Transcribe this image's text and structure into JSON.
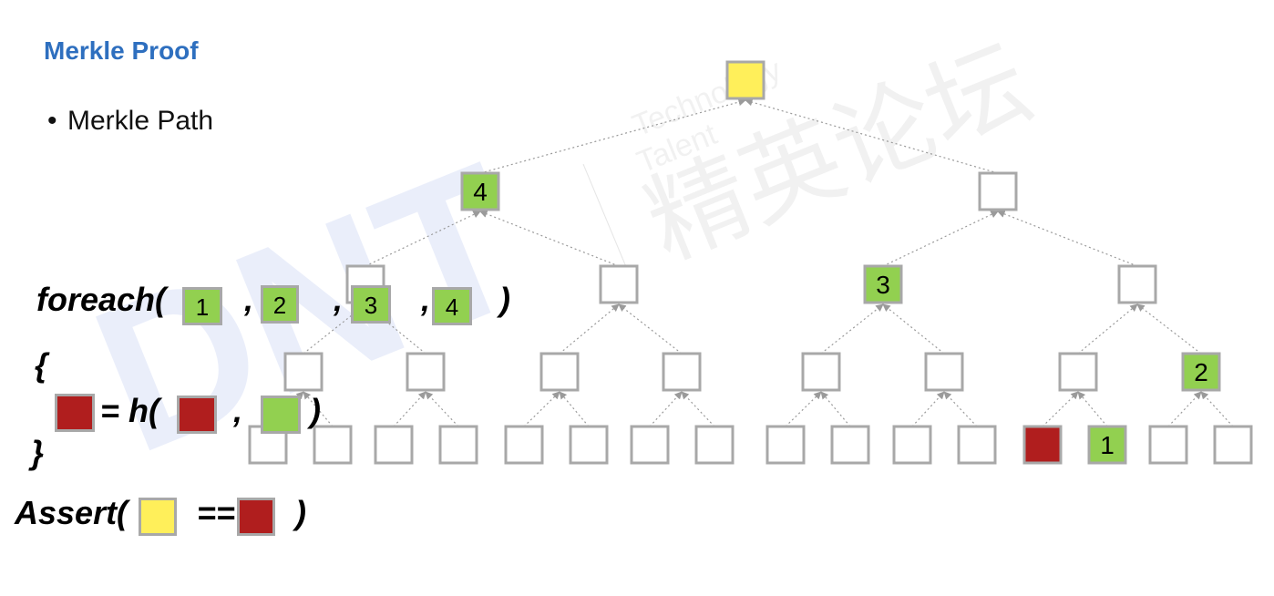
{
  "title": "Merkle Proof",
  "bullet": "Merkle Path",
  "colors": {
    "green": "#92d050",
    "yellow": "#ffef5a",
    "red": "#b01e1e",
    "border": "#a8a8a8",
    "title": "#2e6fbf"
  },
  "tree": {
    "levels": [
      [
        "yellow"
      ],
      [
        "4",
        ""
      ],
      [
        "",
        "",
        "3",
        ""
      ],
      [
        "",
        "",
        "",
        "",
        "",
        "",
        "",
        "2"
      ],
      [
        "",
        "",
        "",
        "",
        "",
        "",
        "",
        "",
        "",
        "",
        "",
        "",
        "red",
        "1",
        "",
        ""
      ]
    ]
  },
  "code": {
    "foreach_kw": "foreach(",
    "foreach_items": [
      "1",
      "2",
      "3",
      "4"
    ],
    "comma": ",",
    "close_paren": ")",
    "open_brace": "{",
    "close_brace": "}",
    "assign": "= h(",
    "assert_kw": "Assert(",
    "equals": "=="
  }
}
